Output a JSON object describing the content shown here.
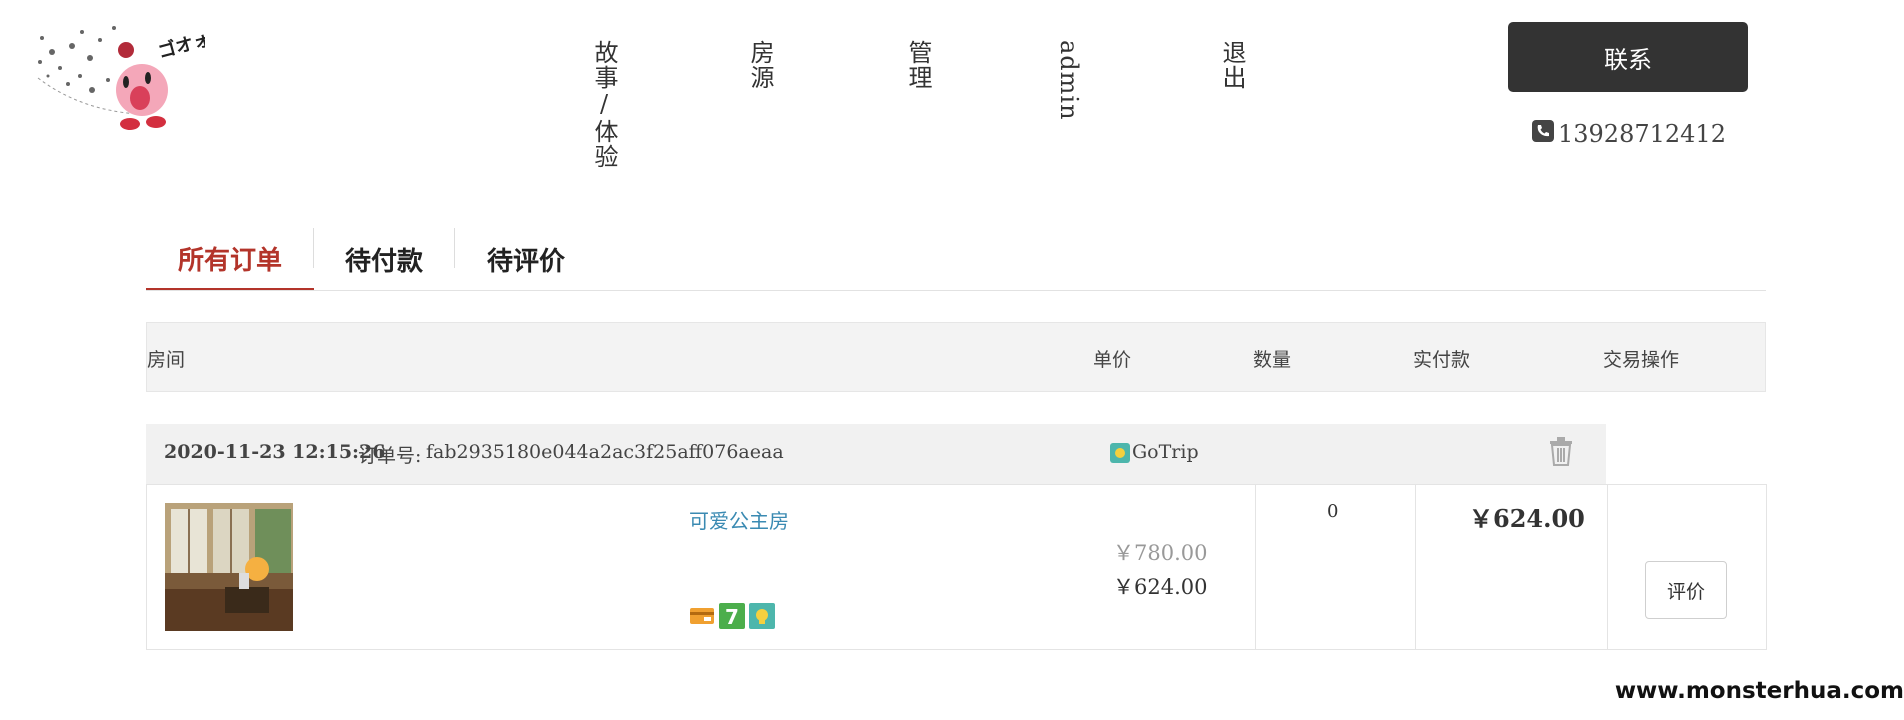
{
  "nav": {
    "items": [
      {
        "label": "故事/体验"
      },
      {
        "label": "房源"
      },
      {
        "label": "管理"
      },
      {
        "label": "admin"
      },
      {
        "label": "退出"
      }
    ],
    "contact_label": "联系",
    "phone": "13928712412"
  },
  "tabs": [
    {
      "label": "所有订单",
      "active": true
    },
    {
      "label": "待付款",
      "active": false
    },
    {
      "label": "待评价",
      "active": false
    }
  ],
  "table_header": {
    "room": "房间",
    "unit_price": "单价",
    "quantity": "数量",
    "paid": "实付款",
    "actions": "交易操作"
  },
  "order": {
    "datetime": "2020-11-23 12:15:26",
    "order_no_label": "订单号:",
    "order_no": "fab2935180e044a2ac3f25aff076aeaa",
    "vendor": "GoTrip",
    "room_name": "可爱公主房",
    "original_price": "￥780.00",
    "price": "￥624.00",
    "quantity": "0",
    "paid": "￥624.00",
    "review_label": "评价"
  },
  "watermark": "www.monsterhua.com",
  "colors": {
    "accent": "#b3342a",
    "link": "#3a8ab2",
    "dark_button": "#333333"
  }
}
